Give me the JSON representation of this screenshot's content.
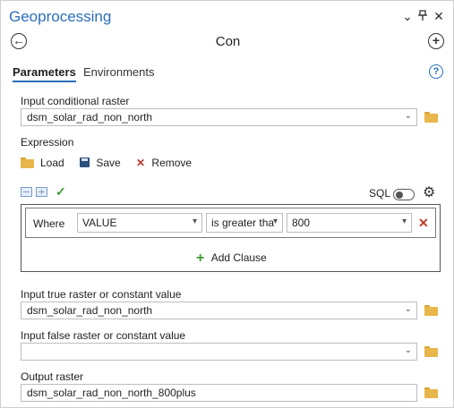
{
  "pane": {
    "title": "Geoprocessing",
    "controls": {
      "menu": "⌄",
      "pin": "ⵐ",
      "close": "✕"
    }
  },
  "tool": {
    "name": "Con",
    "back_icon": "back-arrow-icon",
    "add_icon": "add-icon"
  },
  "tabs": [
    {
      "label": "Parameters",
      "active": true
    },
    {
      "label": "Environments",
      "active": false
    }
  ],
  "help_icon": "?",
  "params": {
    "input_conditional_raster": {
      "label": "Input conditional raster",
      "value": "dsm_solar_rad_non_north"
    },
    "expression": {
      "label": "Expression",
      "load_label": "Load",
      "save_label": "Save",
      "remove_label": "Remove",
      "sql_label": "SQL",
      "clause": {
        "where": "Where",
        "field": "VALUE",
        "operator": "is greater tha",
        "value": "800"
      },
      "add_clause_label": "Add Clause"
    },
    "input_true": {
      "label": "Input true raster or constant value",
      "value": "dsm_solar_rad_non_north"
    },
    "input_false": {
      "label": "Input false raster or constant value",
      "value": ""
    },
    "output_raster": {
      "label": "Output raster",
      "value": "dsm_solar_rad_non_north_800plus"
    }
  },
  "colors": {
    "accent": "#2a6ebb",
    "folder": "#e8b64a",
    "remove": "#c0392b",
    "check": "#3a9d2f"
  }
}
